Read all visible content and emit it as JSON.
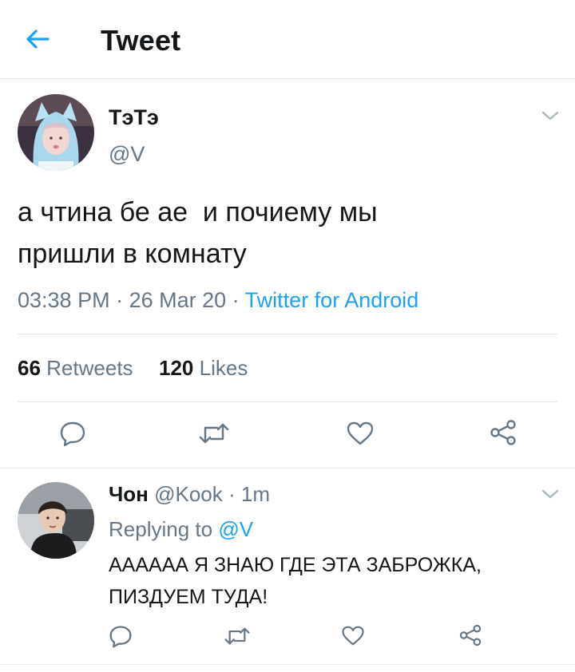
{
  "header": {
    "title": "Tweet"
  },
  "tweet": {
    "display_name": "ТэТэ",
    "handle": "@V",
    "text_line1": "а чтина бе ае  и почиему мы",
    "text_line2": "пришли в комнату",
    "time": "03:38 PM",
    "sep1": " · ",
    "date": "26 Mar 20",
    "sep2": " · ",
    "source": "Twitter for Android",
    "retweets_count": "66",
    "retweets_label": "Retweets",
    "likes_count": "120",
    "likes_label": "Likes"
  },
  "reply": {
    "display_name": "Чон",
    "handle": "@Kook",
    "sep": " · ",
    "age": "1m",
    "replying_label": "Replying to",
    "replying_handle": "@V",
    "text_line1": "АААААА Я ЗНАЮ ГДЕ ЭТА ЗАБРОЖКА,",
    "text_line2": "ПИЗДУЕМ ТУДА!"
  },
  "icons": {
    "back": "arrow-left-icon",
    "menu": "chevron-down-icon",
    "reply": "reply-bubble-icon",
    "retweet": "retweet-icon",
    "like": "heart-icon",
    "share": "share-icon"
  },
  "colors": {
    "accent": "#1da1f2",
    "muted": "#657786",
    "text": "#14171a",
    "divider": "#e1e8ed"
  }
}
